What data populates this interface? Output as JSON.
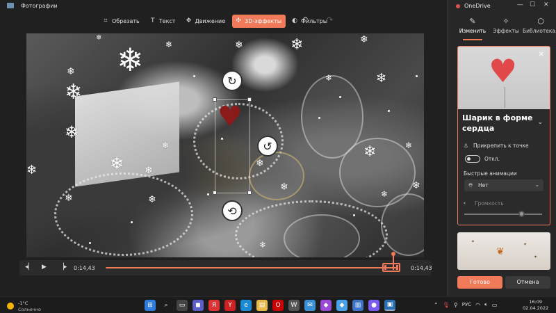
{
  "app": {
    "title": "Фотографии"
  },
  "toolbar": {
    "items": [
      {
        "label": "Обрезать",
        "icon": "crop-icon",
        "active": false
      },
      {
        "label": "Текст",
        "icon": "text-icon",
        "active": false
      },
      {
        "label": "Движение",
        "icon": "motion-icon",
        "active": false
      },
      {
        "label": "3D-эффекты",
        "icon": "3d-effects-icon",
        "active": true
      },
      {
        "label": "Фильтры",
        "icon": "filters-icon",
        "active": false
      }
    ]
  },
  "player": {
    "current_time": "0:14,43",
    "end_time": "0:14,43",
    "progress": 0.96
  },
  "panel": {
    "title": "OneDrive",
    "tabs": [
      {
        "label": "Изменить",
        "icon": "pencil-icon",
        "active": true
      },
      {
        "label": "Эффекты",
        "icon": "sparkle-icon",
        "active": false
      },
      {
        "label": "Библиотека...",
        "icon": "cube-icon",
        "active": false
      }
    ],
    "effect": {
      "title": "Шарик в форме сердца",
      "attach_label": "Прикрепить к точке",
      "toggle_label": "Откл.",
      "toggle_on": false,
      "anim_label": "Быстрые анимации",
      "anim_value": "Нет",
      "volume_label": "Громкость",
      "volume_level": 0.75
    },
    "done_label": "Готово",
    "cancel_label": "Отмена"
  },
  "taskbar": {
    "weather_temp": "-1°C",
    "weather_desc": "Солнечно",
    "lang": "РУС",
    "time": "16:09",
    "date": "02.04.2022"
  },
  "colors": {
    "accent": "#f07a5a"
  }
}
